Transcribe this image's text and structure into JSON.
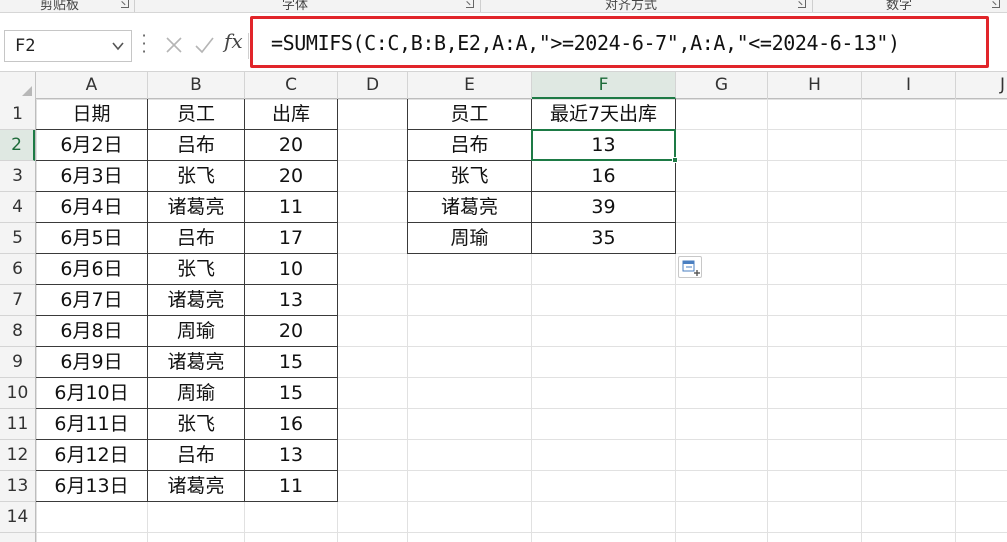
{
  "ribbon": {
    "groups": [
      "剪贴板",
      "字体",
      "对齐方式",
      "数字"
    ]
  },
  "namebox": {
    "value": "F2"
  },
  "formula_bar": {
    "fx_label": "fx",
    "formula": "=SUMIFS(C:C,B:B,E2,A:A,\">=2024-6-7\",A:A,\"<=2024-6-13\")"
  },
  "sheet": {
    "columns": [
      "A",
      "B",
      "C",
      "D",
      "E",
      "F",
      "G",
      "H",
      "I",
      "J"
    ],
    "selected_column": "F",
    "rows": [
      "1",
      "2",
      "3",
      "4",
      "5",
      "6",
      "7",
      "8",
      "9",
      "10",
      "11",
      "12",
      "13",
      "14"
    ],
    "selected_row": "2",
    "selected_cell": "F2",
    "table1": {
      "headers": [
        "日期",
        "员工",
        "出库"
      ],
      "rows": [
        [
          "6月2日",
          "吕布",
          "20"
        ],
        [
          "6月3日",
          "张飞",
          "20"
        ],
        [
          "6月4日",
          "诸葛亮",
          "11"
        ],
        [
          "6月5日",
          "吕布",
          "17"
        ],
        [
          "6月6日",
          "张飞",
          "10"
        ],
        [
          "6月7日",
          "诸葛亮",
          "13"
        ],
        [
          "6月8日",
          "周瑜",
          "20"
        ],
        [
          "6月9日",
          "诸葛亮",
          "15"
        ],
        [
          "6月10日",
          "周瑜",
          "15"
        ],
        [
          "6月11日",
          "张飞",
          "16"
        ],
        [
          "6月12日",
          "吕布",
          "13"
        ],
        [
          "6月13日",
          "诸葛亮",
          "11"
        ]
      ]
    },
    "table2": {
      "headers": [
        "员工",
        "最近7天出库"
      ],
      "rows": [
        [
          "吕布",
          "13"
        ],
        [
          "张飞",
          "16"
        ],
        [
          "诸葛亮",
          "39"
        ],
        [
          "周瑜",
          "35"
        ]
      ]
    }
  },
  "colors": {
    "formula_highlight": "#e1252a",
    "selection": "#1d7a45",
    "header_bg": "#f4f4f4"
  },
  "icons": {
    "namebox_dropdown": "chevron-down-icon",
    "cancel": "close-icon",
    "confirm": "check-icon",
    "paste_options": "paste-options-icon"
  }
}
